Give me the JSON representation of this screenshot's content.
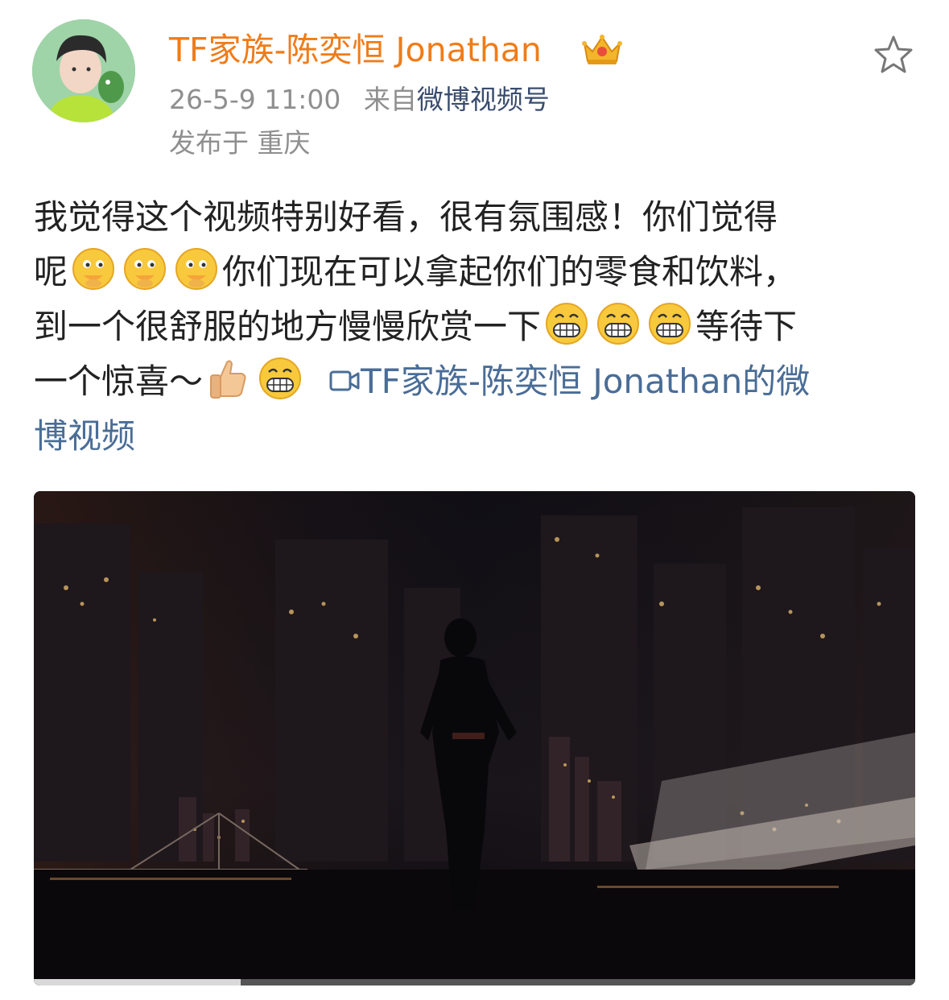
{
  "header": {
    "username": "TF家族-陈奕恒 Jonathan",
    "timestamp": "26-5-9 11:00",
    "source_prefix": "来自",
    "source": "微博视频号",
    "location": "发布于 重庆",
    "badge_icon": "crown-badge-icon",
    "favorite_icon": "star-icon"
  },
  "post": {
    "line1": "我觉得这个视频特别好看，很有氛围感！你们觉得",
    "line2_a": "呢",
    "line2_b": "你们现在可以拿起你们的零食和饮料，",
    "line3_a": "到一个很舒服的地方慢慢欣赏一下",
    "line3_b": "等待下",
    "line4_a": "一个惊喜～",
    "video_link_a": "TF家族-陈奕恒 Jonathan的微",
    "video_link_b": "博视频",
    "emojis": [
      "thinking-face-emoji",
      "grin-emoji",
      "thumbs-up-emoji"
    ]
  },
  "video": {
    "progress": 0.235,
    "colors": {
      "accent": "#f07c18",
      "link": "#4a6d97"
    }
  }
}
